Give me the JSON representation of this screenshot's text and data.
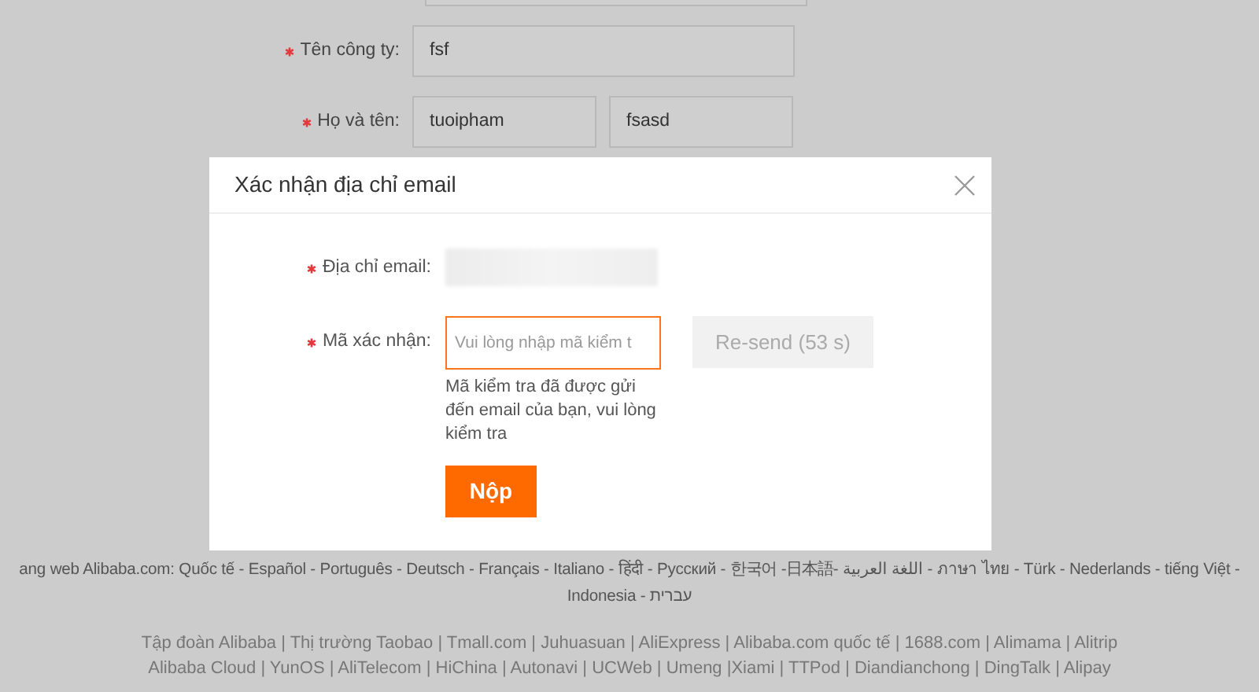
{
  "background_form": {
    "rows": [
      {
        "label": "Tên công ty:",
        "required": true,
        "values": [
          "fsf"
        ]
      },
      {
        "label": "Họ và tên:",
        "required": true,
        "values": [
          "tuoipham",
          "fsasd"
        ]
      }
    ]
  },
  "modal": {
    "title": "Xác nhận địa chỉ email",
    "fields": [
      {
        "kind": "readonly",
        "label": "Địa chỉ email:",
        "required": true
      },
      {
        "kind": "code",
        "label": "Mã xác nhận:",
        "required": true,
        "placeholder": "Vui lòng nhập mã kiểm t",
        "focused": true,
        "resend": {
          "label": "Re-send (53 s)",
          "disabled": true
        },
        "hint": "Mã kiểm tra đã được gửi đến email của bạn, vui lòng kiểm tra"
      }
    ],
    "submit": "Nộp"
  },
  "footer": {
    "languages": [
      "ang web Alibaba.com: Quốc tế - Español - Português - Deutsch - Français - Italiano - हिंदी - Русский - 한국어 -日本語- اللغة العربية - ภาษา ไทย - Türk - Nederlands - tiếng Việt -",
      "Indonesia - עברית"
    ],
    "links": [
      "Tập đoàn Alibaba | Thị trường Taobao | Tmall.com | Juhuasuan | AliExpress | Alibaba.com quốc tế | 1688.com | Alimama | Alitrip",
      "Alibaba Cloud | YunOS | AliTelecom | HiChina | Autonavi | UCWeb | Umeng |Xiami | TTPod | Diandianchong | DingTalk | Alipay"
    ]
  }
}
